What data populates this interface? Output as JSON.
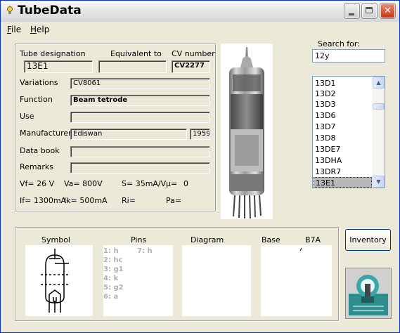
{
  "window": {
    "title": "TubeData",
    "icon": "lightbulb-icon"
  },
  "menu": [
    {
      "first": "F",
      "rest": "ile"
    },
    {
      "first": "H",
      "rest": "elp"
    }
  ],
  "tube": {
    "designation_label": "Tube designation",
    "equivalent_label": "Equivalent to",
    "cv_label": "CV number",
    "designation": "13E1",
    "equivalent": "",
    "cv": "CV2277",
    "variations_label": "Variations",
    "variations": "CV8061",
    "function_label": "Function",
    "function": "Beam tetrode",
    "use_label": "Use",
    "use": "",
    "manufacturer_label": "Manufacturer",
    "manufacturer": "Ediswan",
    "year": "1959",
    "databook_label": "Data book",
    "databook": "",
    "remarks_label": "Remarks",
    "remarks": ""
  },
  "params": {
    "vf": "Vf= 26 V",
    "va": "Va=  800V",
    "s": "S= 35mA/V",
    "mu": "µ=",
    "mu_val": "0",
    "if": "If= 1300mA",
    "ik": "Ik=   500mA",
    "ri": "Ri=",
    "pa": "Pa="
  },
  "search": {
    "label": "Search for:",
    "value": "12y"
  },
  "list": {
    "items": [
      "13D1",
      "13D2",
      "13D3",
      "13D6",
      "13D7",
      "13D8",
      "13DE7",
      "13DHA",
      "13DR7",
      "13E1"
    ],
    "selected": "13E1"
  },
  "bottom": {
    "symbol_label": "Symbol",
    "pins_label": "Pins",
    "diagram_label": "Diagram",
    "base_label": "Base",
    "base_value": "B7A",
    "pins_left": [
      "1: h",
      "2: hc",
      "3: g1",
      "4: k",
      "5: g2",
      "6: a"
    ],
    "pins_right": [
      "7: h"
    ]
  },
  "inventory_button": "Inventory",
  "colors": {
    "accent": "#0831d9",
    "window_bg": "#ece9d8",
    "close_red": "#c83314"
  }
}
